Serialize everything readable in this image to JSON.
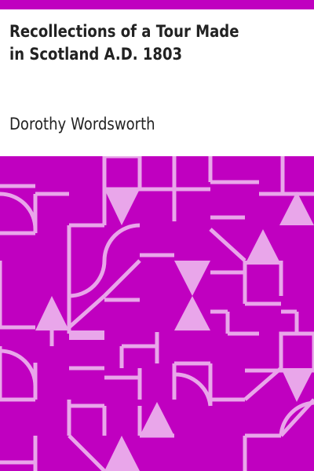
{
  "book": {
    "title": "Recollections of a Tour Made in Scotland A.D. 1803",
    "author": "Dorothy Wordsworth"
  },
  "colors": {
    "accent": "#C000C0",
    "pattern_line": "#E9A6EA",
    "text": "#222222",
    "background": "#FFFFFF"
  }
}
